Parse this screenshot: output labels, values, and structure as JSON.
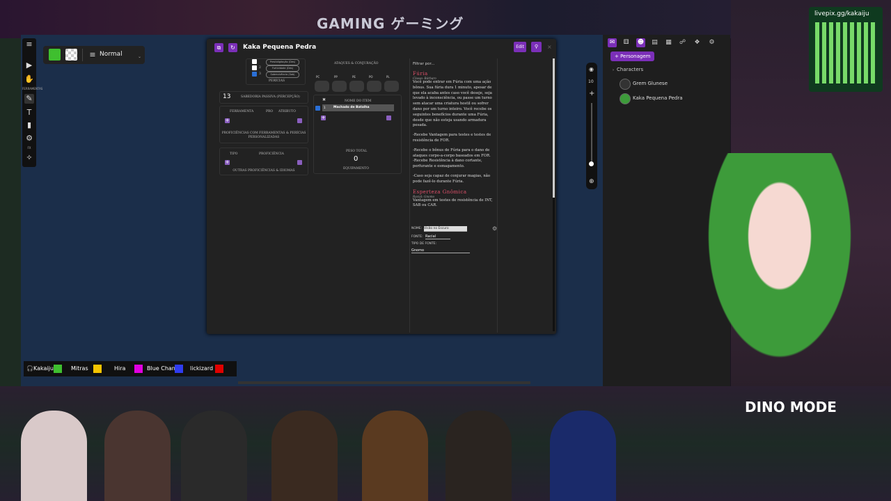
{
  "stream": {
    "sign": "GAMING ゲーミング",
    "qr_label": "livepix.gg/kakaiju",
    "dino_badge": "DINO MODE"
  },
  "vtt": {
    "toolbar": {
      "tools_label": "FERRAMENTAS",
      "fx_label": "FX",
      "icons": [
        "menu-icon",
        "cursor-icon",
        "hand-icon",
        "brush-icon",
        "text-icon",
        "rect-icon",
        "dice-icon",
        "wand-icon"
      ]
    },
    "layer_bar": {
      "color_primary": "#3fbf2f",
      "layer_name": "Normal"
    },
    "sheet": {
      "title": "Kaka Pequena Pedra",
      "edit_label": "Edit",
      "close_label": "×",
      "skills": {
        "rows": [
          {
            "num": "",
            "label": "Prestidigitação (Des)"
          },
          {
            "num": "2",
            "label": "Furtividade (Des)"
          },
          {
            "num": "3",
            "label": "Sobrevivência (Sab)"
          }
        ],
        "title": "PERÍCIAS"
      },
      "passive": {
        "value": "13",
        "label": "SABEDORIA PASSIVA (PERCEPÇÃO)"
      },
      "tools_panel": {
        "col1": "FERRAMENTA",
        "col2": "PRO",
        "col3": "ATRIBUTO",
        "footer": "PROFICIÊNCIAS COM FERRAMENTAS & PERÍCIAS PERSONALIZADAS"
      },
      "other_panel": {
        "col1": "TIPO",
        "col2": "PROFICIÊNCIA",
        "footer": "OUTRAS PROFICIÊNCIAS & IDIOMAS"
      },
      "attacks": {
        "title": "ATAQUES & CONJURAÇÃO",
        "coins": [
          "PC",
          "PP",
          "PE",
          "PO",
          "PL"
        ]
      },
      "inventory": {
        "col_name": "NOME DO ITEM",
        "item_qty": "1",
        "item_name": "Machado de Batalha",
        "weight_label": "PESO TOTAL",
        "weight_value": "0",
        "footer": "EQUIPAMENTO"
      },
      "features": {
        "filter_placeholder": "Filtrar por...",
        "f1_title": "Fúria",
        "f1_source": "Classe: Bárbaro",
        "f1_text": "Você pode entrar em Fúria com uma ação bônus. Sua fúria dura 1 minuto, apesar de que ela acaba antes caso você deseje, seja levado à inconsciência, ou passe um turno sem atacar uma criatura hostil ou sofrer dano por um turno inteiro. Você recebe os seguintes benefícios durante uma Fúria, desde que não esteja usando armadura pesada.",
        "f1_b1": "-Recebe Vantagem para testes e testes de resistência de FOR.",
        "f1_b2": "-Recebe o bônus de Fúria para o dano de ataques corpo-a-corpo baseados em FOR.",
        "f1_b3": "-Recebe Resistência à dano cortante, perfurante e esmagamento.",
        "f1_b4": "-Caso seja capaz de conjurar magias, não pode fazê-lo durante Fúria.",
        "f2_title": "Esperteza Gnômica",
        "f2_source": "Racial: Gnomo",
        "f2_text": "Vantagem em testes de resistência de INT, SAB ou CAR.",
        "name_label": "NOME:",
        "name_value": "Visão no Escuro",
        "source_label": "FONTE:",
        "source_value": "Racial",
        "type_label": "TIPO DE FONTE:",
        "type_value": "Gnomo"
      }
    },
    "zoom": {
      "value": "10"
    },
    "sidebar": {
      "add_label": "+ Personagem",
      "folder_label": "Characters",
      "characters": [
        {
          "name": "Grem Glunese"
        },
        {
          "name": "Kaka Pequena Pedra"
        }
      ]
    },
    "players": [
      {
        "name": "Kakaiju",
        "color": "#3fbf2f"
      },
      {
        "name": "Mitras",
        "color": "#f5c400"
      },
      {
        "name": "Hira",
        "color": "#e000e0"
      },
      {
        "name": "Blue Chan",
        "color": "#2f3cf0"
      },
      {
        "name": "lickizard",
        "color": "#e00000"
      }
    ]
  }
}
